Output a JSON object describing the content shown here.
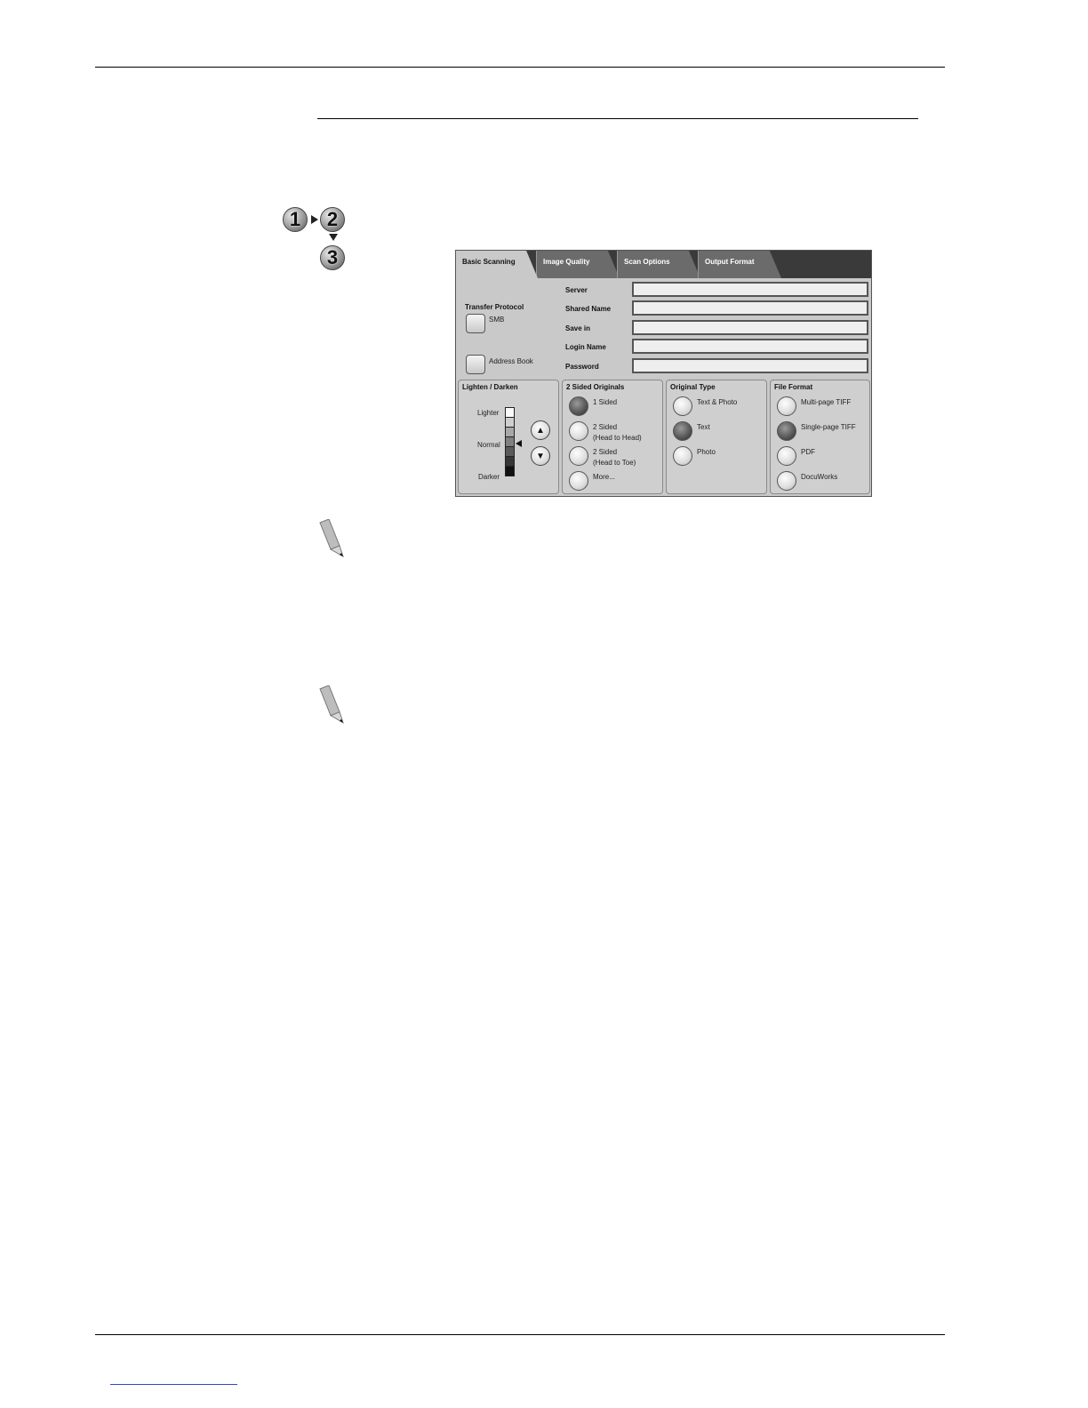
{
  "steps": {
    "one": "1",
    "two": "2",
    "three": "3"
  },
  "tabs": [
    {
      "label": "Basic Scanning",
      "active": true
    },
    {
      "label": "Image Quality",
      "active": false
    },
    {
      "label": "Scan Options",
      "active": false
    },
    {
      "label": "Output Format",
      "active": false
    }
  ],
  "fields": [
    {
      "label": "Server",
      "value": ""
    },
    {
      "label": "Shared Name",
      "value": ""
    },
    {
      "label": "Save in",
      "value": ""
    },
    {
      "label": "Login Name",
      "value": ""
    },
    {
      "label": "Password",
      "value": ""
    }
  ],
  "transfer_protocol": {
    "title": "Transfer Protocol",
    "smb_label": "SMB",
    "address_book_label": "Address Book"
  },
  "lighten_darken": {
    "title": "Lighten / Darken",
    "lighter": "Lighter",
    "normal": "Normal",
    "darker": "Darker",
    "up_icon": "up-arrow",
    "down_icon": "down-arrow"
  },
  "two_sided": {
    "title": "2 Sided Originals",
    "options": [
      "1 Sided",
      "2 Sided\n(Head to Head)",
      "2 Sided\n(Head to Toe)",
      "More..."
    ],
    "selected": "1 Sided"
  },
  "original_type": {
    "title": "Original Type",
    "options": [
      "Text & Photo",
      "Text",
      "Photo"
    ],
    "selected": "Text"
  },
  "file_format": {
    "title": "File Format",
    "options": [
      "Multi-page TIFF",
      "Single-page TIFF",
      "PDF",
      "DocuWorks"
    ],
    "selected": "Single-page TIFF"
  },
  "colors": {
    "panel_bg": "#c9c9c9",
    "tabbar_bg": "#3a3a3a",
    "link": "#2b4bcc"
  }
}
